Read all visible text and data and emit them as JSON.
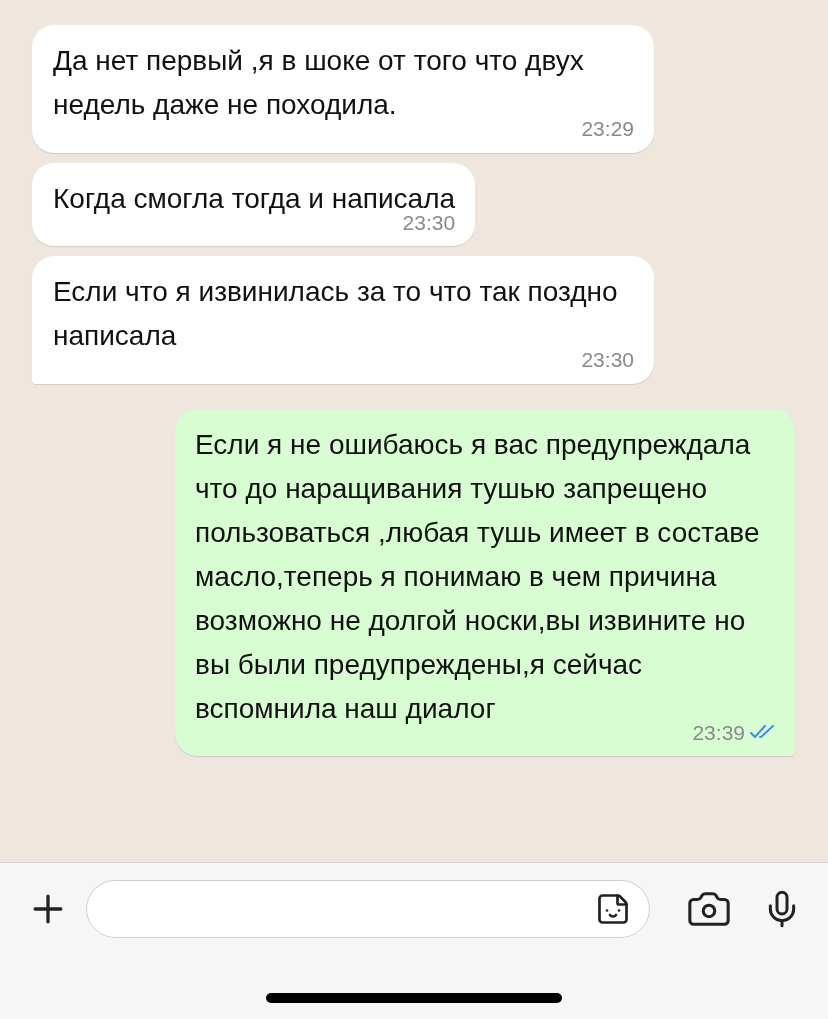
{
  "messages": [
    {
      "kind": "incoming",
      "text": "Да нет первый ,я в шоке от того что двух недель даже не походила.",
      "time": "23:29",
      "tail": false
    },
    {
      "kind": "incoming",
      "text": "Когда смогла тогда и написала",
      "time": "23:30",
      "tail": false
    },
    {
      "kind": "incoming",
      "text": "Если что я извинилась за то что так поздно написала",
      "time": "23:30",
      "tail": true
    },
    {
      "kind": "outgoing",
      "text": "Если я не ошибаюсь я вас предупреждала что до наращивания тушью запрещено пользоваться ,любая тушь имеет в составе масло,теперь я понимаю в чем причина возможно не долгой носки,вы извините но вы были предупреждены,я сейчас вспомнила наш диалог",
      "time": "23:39",
      "read": true,
      "tail": true
    }
  ]
}
